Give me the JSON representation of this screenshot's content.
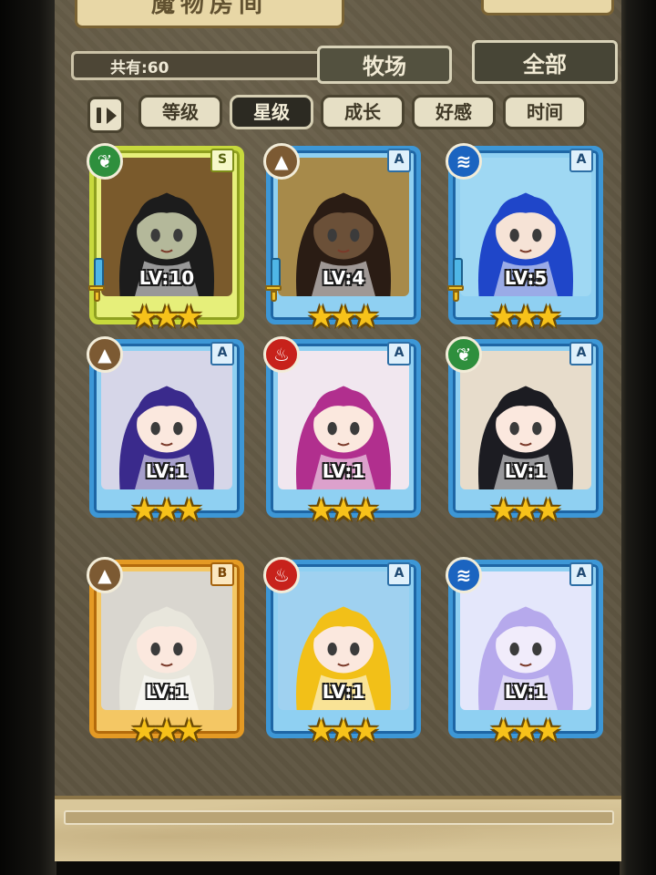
{
  "header": {
    "title": "魔物房间",
    "count_label": "共有:60",
    "tabs": [
      {
        "label": "牧场"
      },
      {
        "label": "全部"
      }
    ]
  },
  "sort": {
    "buttons": [
      {
        "label": "等级",
        "active": false
      },
      {
        "label": "星级",
        "active": true
      },
      {
        "label": "成长",
        "active": false
      },
      {
        "label": "好感",
        "active": false
      },
      {
        "label": "时间",
        "active": false
      }
    ]
  },
  "monsters": [
    {
      "rank": "S",
      "element": "wood",
      "element_icon": "leaf-icon",
      "level": "LV:10",
      "stars": 3,
      "equipped": true,
      "hair": "#1c1c1c",
      "bg": "#7a5a2c",
      "skin": "#b4b89a"
    },
    {
      "rank": "A",
      "element": "earth",
      "element_icon": "mountain-icon",
      "level": "LV:4",
      "stars": 3,
      "equipped": true,
      "hair": "#2a1c14",
      "bg": "#a78a4a",
      "skin": "#6b5038"
    },
    {
      "rank": "A",
      "element": "water",
      "element_icon": "wave-icon",
      "level": "LV:5",
      "stars": 3,
      "equipped": true,
      "hair": "#1f46c9",
      "bg": "#9fd8f3",
      "skin": "#f6e3d6"
    },
    {
      "rank": "A",
      "element": "earth",
      "element_icon": "mountain-icon",
      "level": "LV:1",
      "stars": 3,
      "equipped": false,
      "hair": "#3a2a8c",
      "bg": "#d6d6e8",
      "skin": "#fbe8de"
    },
    {
      "rank": "A",
      "element": "fire",
      "element_icon": "flame-icon",
      "level": "LV:1",
      "stars": 3,
      "equipped": false,
      "hair": "#b12f8e",
      "bg": "#f1e7ef",
      "skin": "#fbe8de"
    },
    {
      "rank": "A",
      "element": "wood",
      "element_icon": "leaf-icon",
      "level": "LV:1",
      "stars": 3,
      "equipped": false,
      "hair": "#1c1c22",
      "bg": "#e7dccb",
      "skin": "#fbe8de"
    },
    {
      "rank": "B",
      "element": "earth",
      "element_icon": "mountain-icon",
      "level": "LV:1",
      "stars": 3,
      "equipped": false,
      "hair": "#e8e6dc",
      "bg": "#d9d6cf",
      "skin": "#fbe8de"
    },
    {
      "rank": "A",
      "element": "fire",
      "element_icon": "flame-icon",
      "level": "LV:1",
      "stars": 3,
      "equipped": false,
      "hair": "#f2c018",
      "bg": "#9fd1f0",
      "skin": "#fbe8de"
    },
    {
      "rank": "A",
      "element": "water",
      "element_icon": "wave-icon",
      "level": "LV:1",
      "stars": 3,
      "equipped": false,
      "hair": "#b6a9ec",
      "bg": "#e4e7fb",
      "skin": "#f1ecfb"
    }
  ],
  "colors": {
    "rank_s": "#c7d93d",
    "rank_a": "#3d97d6",
    "rank_b": "#e49a24",
    "star": "#f7c21a"
  }
}
